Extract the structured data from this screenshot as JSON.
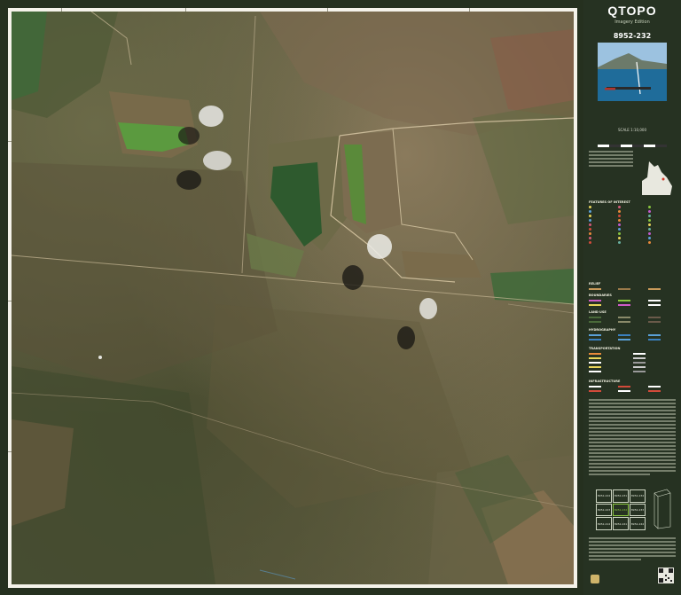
{
  "header": {
    "brand": "QTOPO",
    "edition": "Imagery Edition",
    "sheet_number": "8952-232",
    "scale": "SCALE 1:10,000"
  },
  "legend": {
    "features_title": "FEATURES OF INTEREST",
    "relief_title": "RELIEF",
    "boundaries_title": "BOUNDARIES",
    "land_use_title": "LAND USE",
    "hydrography_title": "HYDROGRAPHY",
    "transportation_title": "TRANSPORTATION",
    "infrastructure_title": "INFRASTRUCTURE"
  },
  "colors": {
    "panel_bg": "#263222",
    "accent_green": "#8ac63f",
    "frame": "#f4f2ea"
  },
  "index_sheets": [
    {
      "label": "8952-224",
      "current": false
    },
    {
      "label": "8952-231",
      "current": false
    },
    {
      "label": "8952-234",
      "current": false
    },
    {
      "label": "8952-223",
      "current": false
    },
    {
      "label": "8952-232",
      "current": true
    },
    {
      "label": "8952-233",
      "current": false
    },
    {
      "label": "8952-214",
      "current": false
    },
    {
      "label": "8952-241",
      "current": false
    },
    {
      "label": "8952-244",
      "current": false
    }
  ]
}
